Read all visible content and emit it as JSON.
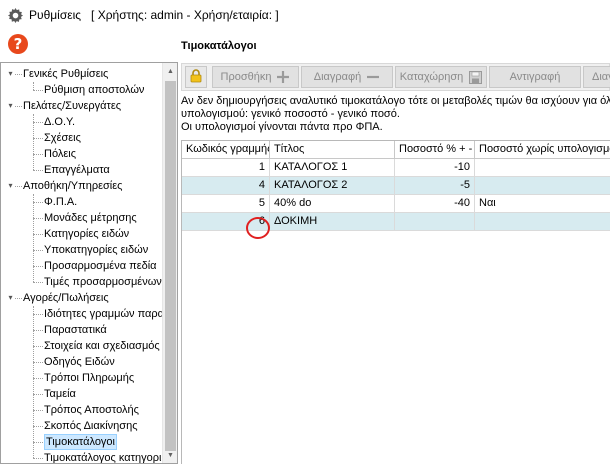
{
  "window": {
    "title": "Ρυθμίσεις",
    "user_info": "[ Χρήστης: admin - Χρήση/εταιρία: ]",
    "icon": "gear-icon"
  },
  "page": {
    "title": "Τιμοκατάλογοι",
    "help_icon_label": "?"
  },
  "tree": {
    "groups": [
      {
        "label": "Γενικές Ρυθμίσεις",
        "items": [
          "Ρύθμιση αποστολών"
        ]
      },
      {
        "label": "Πελάτες/Συνεργάτες",
        "items": [
          "Δ.Ο.Υ.",
          "Σχέσεις",
          "Πόλεις",
          "Επαγγέλματα"
        ]
      },
      {
        "label": "Αποθήκη/Υπηρεσίες",
        "items": [
          "Φ.Π.Α.",
          "Μονάδες μέτρησης",
          "Κατηγορίες ειδών",
          "Υποκατηγορίες ειδών",
          "Προσαρμοσμένα πεδία",
          "Τιμές προσαρμοσμένων"
        ]
      },
      {
        "label": "Αγορές/Πωλήσεις",
        "items": [
          "Ιδιότητες γραμμών παρα",
          "Παραστατικά",
          "Στοιχεία και σχεδιασμός τ",
          "Οδηγός Ειδών",
          "Τρόποι Πληρωμής",
          "Ταμεία",
          "Τρόπος Αποστολής",
          "Σκοπός Διακίνησης",
          "Τιμοκατάλογοι",
          "Τιμοκατάλογος κατηγορι"
        ]
      }
    ],
    "selected": "Τιμοκατάλογοι"
  },
  "toolbar": {
    "add_label": "Προσθήκη",
    "delete_label": "Διαγραφή",
    "save_label": "Καταχώρηση",
    "copy_label": "Αντιγραφή",
    "next_label": "Διαγ"
  },
  "info": {
    "line1": "Αν δεν δημιουργήσεις αναλυτικό τιμοκατάλογο τότε οι μεταβολές τιμών θα ισχύουν για όλα τα είδη με τον γενικό τρόπο",
    "line2": "υπολογισμού: γενικό ποσοστό - γενικό ποσό.",
    "line3": "Οι υπολογισμοί γίνονται πάντα προ ΦΠΑ."
  },
  "grid": {
    "columns": [
      "Κωδικός γραμμής",
      "Τίτλος",
      "Ποσοστό % + -",
      "Ποσοστό χωρίς υπολογισμό"
    ],
    "rows": [
      {
        "code": "1",
        "title": "ΚΑΤΑΛΟΓΟΣ 1",
        "percent": "-10",
        "no_calc": ""
      },
      {
        "code": "4",
        "title": "ΚΑΤΑΛΟΓΟΣ 2",
        "percent": "-5",
        "no_calc": ""
      },
      {
        "code": "5",
        "title": "40% do",
        "percent": "-40",
        "no_calc": "Ναι"
      },
      {
        "code": "6",
        "title": "ΔΟΚΙΜΗ",
        "percent": "",
        "no_calc": ""
      }
    ]
  },
  "colors": {
    "alt_row": "#d7ebf0",
    "highlight_circle": "#e02020",
    "help_icon": "#e8481c",
    "tree_selection": "#cde8ff"
  }
}
